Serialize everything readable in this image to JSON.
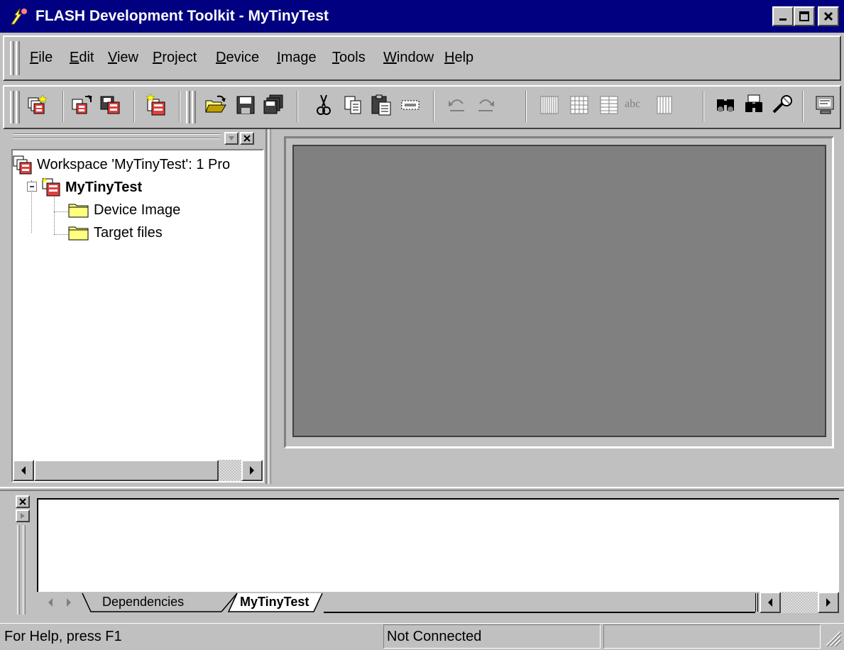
{
  "window": {
    "title": "FLASH Development Toolkit - MyTinyTest",
    "icon": "flash-app-icon",
    "controls": [
      "minimize-icon",
      "maximize-icon",
      "close-icon"
    ]
  },
  "menu": {
    "items": [
      {
        "pre": "",
        "key": "F",
        "post": "ile"
      },
      {
        "pre": "",
        "key": "E",
        "post": "dit"
      },
      {
        "pre": "",
        "key": "V",
        "post": "iew"
      },
      {
        "pre": "",
        "key": "P",
        "post": "roject"
      },
      {
        "pre": "",
        "key": "D",
        "post": "evice"
      },
      {
        "pre": "",
        "key": "I",
        "post": "mage"
      },
      {
        "pre": "",
        "key": "T",
        "post": "ools"
      },
      {
        "pre": "",
        "key": "W",
        "post": "indow"
      },
      {
        "pre": "",
        "key": "H",
        "post": "elp"
      }
    ]
  },
  "toolbar": {
    "icons": [
      "new-workspace-icon",
      "open-workspace-icon",
      "save-workspace-icon",
      "new-project-icon",
      "open-file-icon",
      "save-icon",
      "save-all-icon",
      "cut-icon",
      "copy-icon",
      "paste-icon",
      "select-icon",
      "undo-icon",
      "redo-icon",
      "view-8bit-icon",
      "view-16bit-icon",
      "view-32bit-icon",
      "view-ascii-icon",
      "view-mixed-icon",
      "find-icon",
      "find-in-files-icon",
      "replace-icon",
      "monitor-icon"
    ],
    "ascii_label": "abc"
  },
  "workspace": {
    "root_label": "Workspace 'MyTinyTest': 1 Pro",
    "project_label": "MyTinyTest",
    "children": [
      "Device Image",
      "Target files"
    ]
  },
  "output": {
    "tabs": [
      "Dependencies",
      "MyTinyTest"
    ],
    "active_tab": "MyTinyTest"
  },
  "status": {
    "help": "For Help, press F1",
    "connection": "Not Connected",
    "extra": ""
  },
  "colors": {
    "titlebar": "#000080",
    "face": "#c0c0c0",
    "mdi_background": "#808080"
  }
}
